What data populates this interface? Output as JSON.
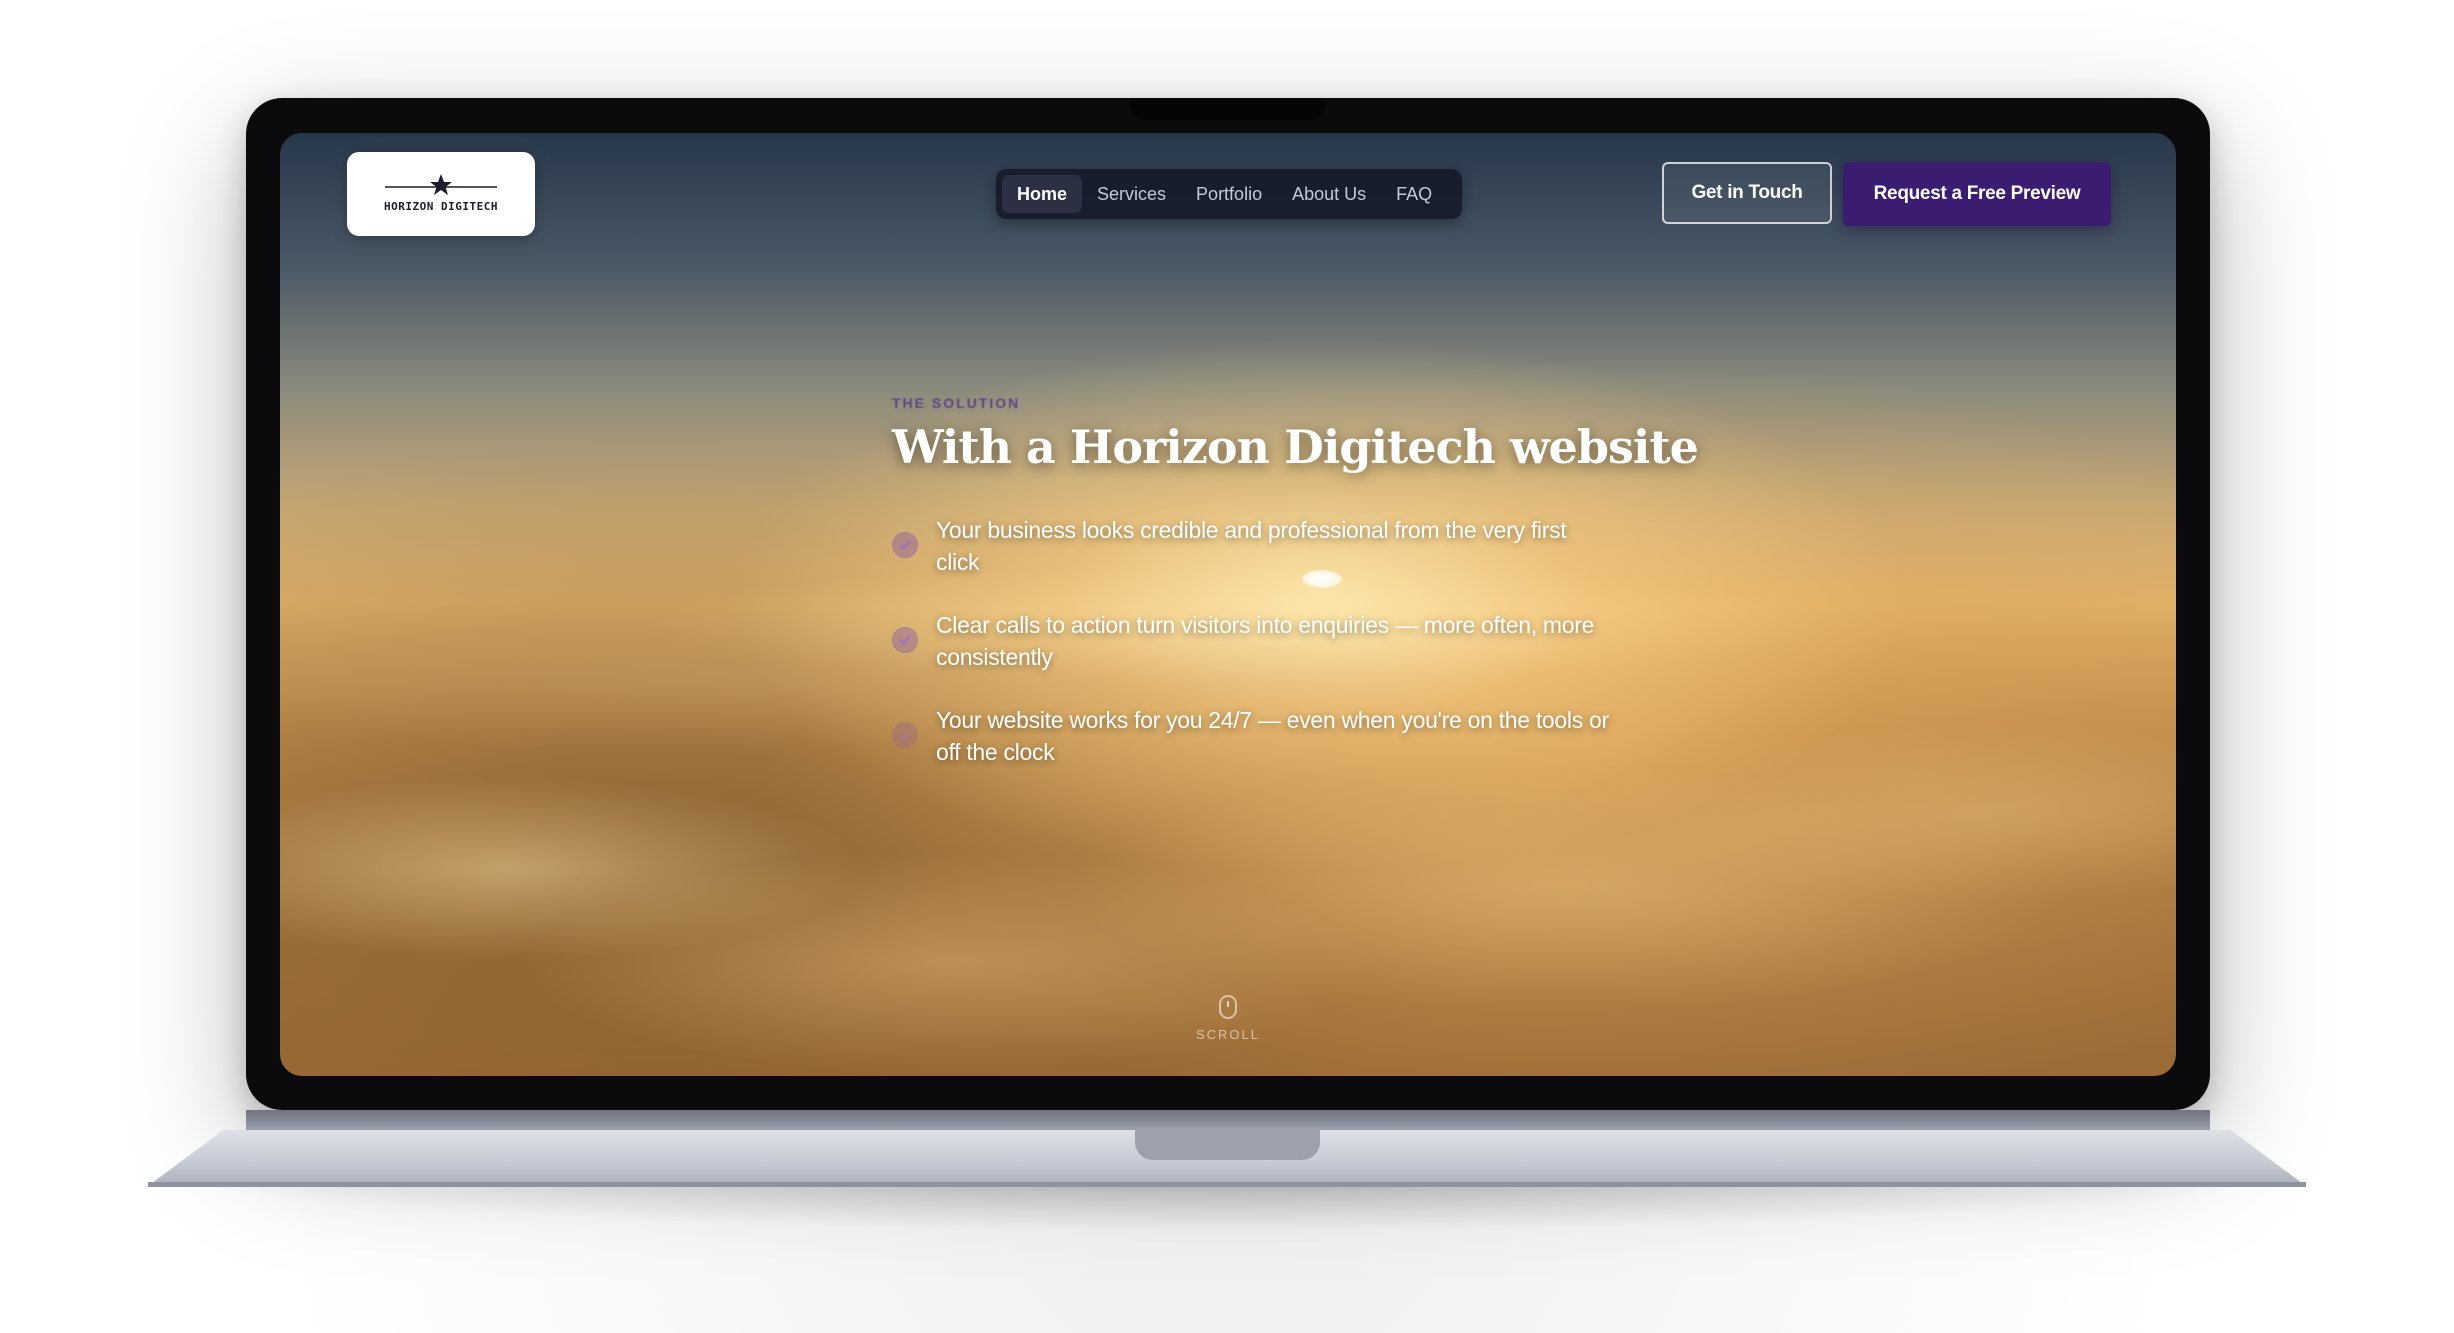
{
  "brand": {
    "logo_text": "HORIZON DIGITECH"
  },
  "nav": {
    "items": [
      {
        "label": "Home",
        "active": true
      },
      {
        "label": "Services",
        "active": false
      },
      {
        "label": "Portfolio",
        "active": false
      },
      {
        "label": "About Us",
        "active": false
      },
      {
        "label": "FAQ",
        "active": false
      }
    ]
  },
  "actions": {
    "contact_label": "Get in Touch",
    "preview_label": "Request a Free Preview"
  },
  "hero": {
    "eyebrow": "THE SOLUTION",
    "title": "With a Horizon Digitech website",
    "benefits": [
      "Your business looks credible and professional from the very first click",
      "Clear calls to action turn visitors into enquiries — more often, more consistently",
      "Your website works for you 24/7 — even when you're on the tools or off the clock"
    ]
  },
  "scroll": {
    "label": "SCROLL"
  },
  "colors": {
    "accent": "#3a1c70",
    "nav_bg": "#141826",
    "check": "#7846aa"
  }
}
